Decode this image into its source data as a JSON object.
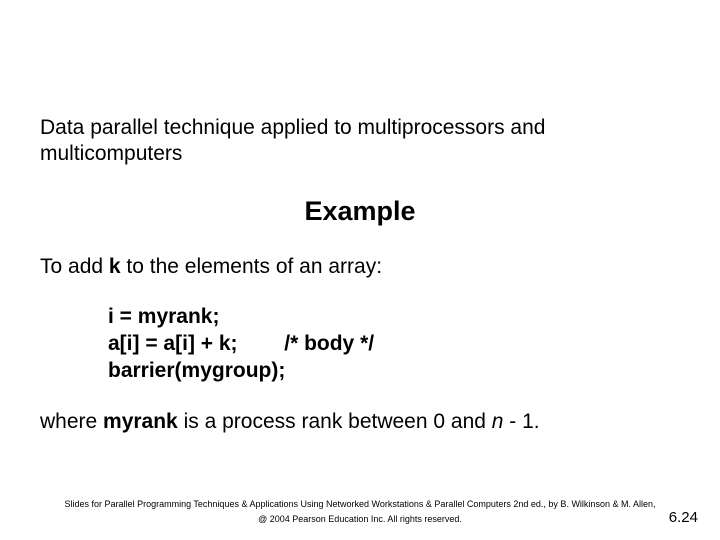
{
  "intro": "Data parallel technique applied to multiprocessors and multicomputers",
  "heading": "Example",
  "lead_pre": "To add ",
  "lead_k": "k",
  "lead_post": " to the elements of an array:",
  "code": {
    "l1": "i = myrank;",
    "l2a": "a[i] = a[i] + k;",
    "l2b": "/* body */",
    "l3": "barrier(mygroup);"
  },
  "closing": {
    "t1": "where ",
    "kw": "myrank",
    "t2": " is a process rank between 0 and ",
    "it": "n",
    "t3": " - 1."
  },
  "footer": {
    "line1": "Slides for Parallel Programming Techniques & Applications Using Networked Workstations & Parallel Computers 2nd ed., by B. Wilkinson & M. Allen,",
    "line2": "@ 2004 Pearson Education Inc. All rights reserved."
  },
  "pagenum": "6.24"
}
